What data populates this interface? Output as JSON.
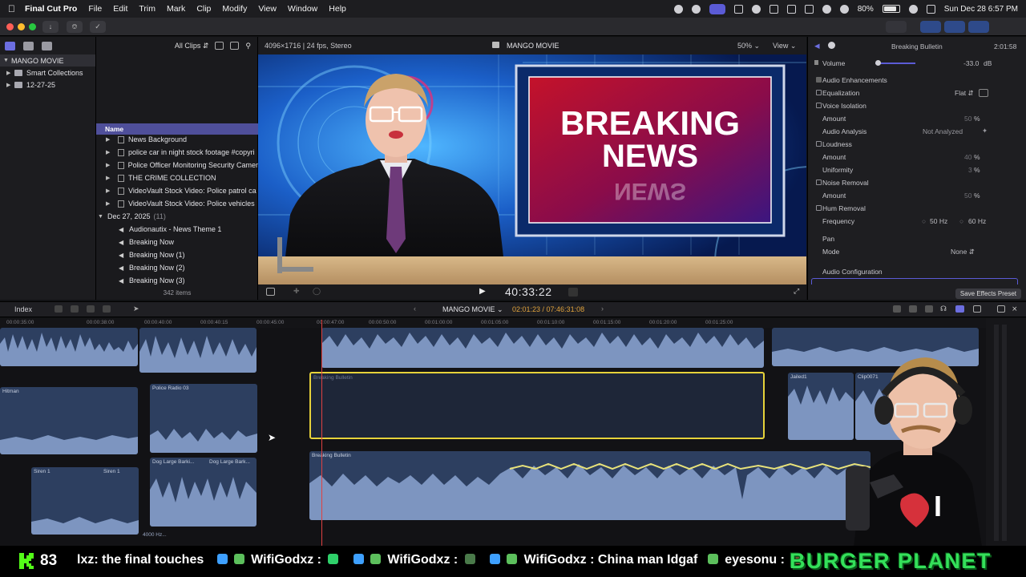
{
  "menubar": {
    "app_name": "Final Cut Pro",
    "items": [
      "File",
      "Edit",
      "Trim",
      "Mark",
      "Clip",
      "Modify",
      "View",
      "Window",
      "Help"
    ],
    "battery": "80%",
    "datetime": "Sun Dec 28  6:57 PM"
  },
  "library": {
    "items": [
      {
        "label": "MANGO MOVIE"
      },
      {
        "label": "Smart Collections"
      },
      {
        "label": "12-27-25"
      }
    ]
  },
  "browser": {
    "filter": "All Clips",
    "column_name": "Name",
    "rows": [
      {
        "label": "News Background",
        "kind": "folder"
      },
      {
        "label": "police  car in night stock footage #copyri",
        "kind": "video"
      },
      {
        "label": "Police Officer Monitoring Security Camer",
        "kind": "video"
      },
      {
        "label": "THE CRIME COLLECTION",
        "kind": "video"
      },
      {
        "label": "VideoVault Stock Video:   Police patrol ca",
        "kind": "video"
      },
      {
        "label": "VideoVault Stock Video:   Police vehicles",
        "kind": "video"
      },
      {
        "label": "Dec 27, 2025",
        "kind": "group",
        "count": "(11)"
      },
      {
        "label": "Audionautix - News Theme 1",
        "kind": "audio"
      },
      {
        "label": "Breaking Now",
        "kind": "audio"
      },
      {
        "label": "Breaking Now (1)",
        "kind": "audio"
      },
      {
        "label": "Breaking Now (2)",
        "kind": "audio"
      },
      {
        "label": "Breaking Now (3)",
        "kind": "audio"
      }
    ],
    "item_count": "342 items"
  },
  "viewer": {
    "format": "4096×1716 | 24 fps, Stereo",
    "project": "MANGO MOVIE",
    "zoom": "50%",
    "view_label": "View",
    "timecode": "40:33:22",
    "graphic_line1": "BREAKING",
    "graphic_line2": "NEWS"
  },
  "inspector": {
    "clip_name": "Breaking Bulletin",
    "duration": "2:01:58",
    "volume_label": "Volume",
    "volume_value": "-33.0",
    "volume_unit": "dB",
    "enhancements_label": "Audio Enhancements",
    "equalization_label": "Equalization",
    "equalization_value": "Flat",
    "voice_isolation_label": "Voice Isolation",
    "amount_label": "Amount",
    "voice_amount": "50",
    "percent": "%",
    "analysis_label": "Audio Analysis",
    "analysis_value": "Not Analyzed",
    "loudness_label": "Loudness",
    "loudness_amount": "40",
    "uniformity_label": "Uniformity",
    "uniformity_value": "3",
    "noise_label": "Noise Removal",
    "noise_amount": "50",
    "hum_label": "Hum Removal",
    "frequency_label": "Frequency",
    "freq_50": "50 Hz",
    "freq_60": "60 Hz",
    "pan_label": "Pan",
    "mode_label": "Mode",
    "mode_value": "None",
    "config_label": "Audio Configuration",
    "save_preset": "Save Effects Preset"
  },
  "timeline": {
    "index_label": "Index",
    "project": "MANGO MOVIE",
    "position": "02:01:23 / 07:46:31:08",
    "ruler": [
      "00:00:35:00",
      "00:00:38:00",
      "00:00:40:00",
      "00:00:40:15",
      "00:00:45:00",
      "00:00:47:00",
      "00:00:50:00",
      "00:01:00:00",
      "00:01:05:00",
      "00:01:10:00",
      "00:01:15:00",
      "00:01:20:00",
      "00:01:25:00"
    ],
    "clips": {
      "hitman": "Hitman",
      "police_radio": "Police Radio 03",
      "breaking_sel": "Breaking Bulletin",
      "jailed": "Jailed1",
      "clip0071": "Clip0071",
      "siren_a": "Siren 1",
      "siren_b": "Siren 1",
      "dog_a": "Dog Large Barki...",
      "dog_b": "Dog Large Bark...",
      "breaking_main": "Breaking Bulletin",
      "hz_label": "4000 Hz..."
    }
  },
  "chat": {
    "viewers": "83",
    "messages": [
      {
        "user": "lxz",
        "text": ": the final touches"
      },
      {
        "user": "WifiGodxz",
        "text": " :"
      },
      {
        "user": "WifiGodxz",
        "text": " :"
      },
      {
        "user": "WifiGodxz",
        "text": " : China man Idgaf"
      },
      {
        "user": "eyesonu",
        "text": " :"
      }
    ],
    "sponsor": "BURGER PLANET"
  },
  "colors": {
    "accent": "#5b5bd6",
    "selection": "#e6d23a",
    "playhead": "#e04141",
    "waveform": "#7d95c0",
    "kick_green": "#53fc18"
  }
}
